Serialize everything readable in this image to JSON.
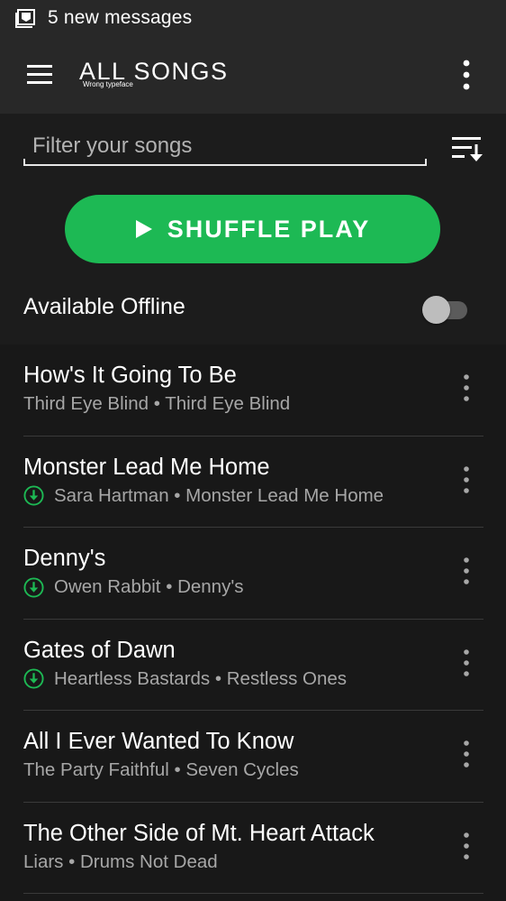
{
  "status_bar": {
    "notification_text": "5 new messages",
    "icon": "mail-icon"
  },
  "toolbar": {
    "title": "ALL SONGS",
    "title_note": "Wrong typeface",
    "menu_icon": "hamburger-menu-icon",
    "more_icon": "more-vertical-icon"
  },
  "filter": {
    "placeholder": "Filter your songs",
    "value": "",
    "sort_icon": "sort-icon"
  },
  "shuffle": {
    "label": "SHUFFLE PLAY",
    "icon": "play-icon"
  },
  "offline": {
    "label": "Available Offline",
    "enabled": false
  },
  "colors": {
    "accent": "#1db954",
    "background": "#181818",
    "toolbar": "#282828",
    "secondary_text": "#a7a7a7"
  },
  "songs": [
    {
      "title": "How's It Going To Be",
      "artist": "Third Eye Blind",
      "album": "Third Eye Blind",
      "meta": "Third Eye Blind • Third Eye Blind",
      "downloaded": false
    },
    {
      "title": "Monster Lead Me Home",
      "artist": "Sara Hartman",
      "album": "Monster Lead Me Home",
      "meta": "Sara Hartman • Monster Lead Me Home",
      "downloaded": true
    },
    {
      "title": "Denny's",
      "artist": "Owen Rabbit",
      "album": "Denny's",
      "meta": "Owen Rabbit • Denny's",
      "downloaded": true
    },
    {
      "title": "Gates of Dawn",
      "artist": "Heartless Bastards",
      "album": "Restless Ones",
      "meta": "Heartless Bastards • Restless Ones",
      "downloaded": true
    },
    {
      "title": "All I Ever Wanted To Know",
      "artist": "The Party Faithful",
      "album": "Seven Cycles",
      "meta": "The Party Faithful • Seven Cycles",
      "downloaded": false
    },
    {
      "title": "The Other Side of Mt. Heart Attack",
      "artist": "Liars",
      "album": "Drums Not Dead",
      "meta": "Liars • Drums Not Dead",
      "downloaded": false
    }
  ]
}
